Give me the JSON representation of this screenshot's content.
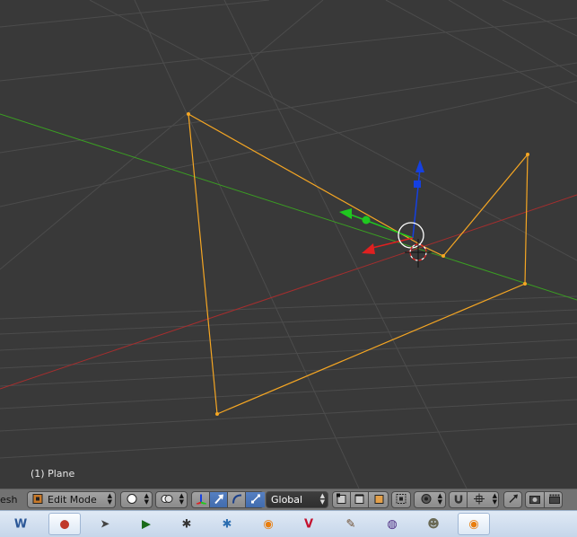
{
  "viewport": {
    "object_info": "(1) Plane"
  },
  "header": {
    "editor_label": "esh",
    "mode_label": "Edit Mode",
    "orientation_label": "Global"
  },
  "icons": {
    "mode": "edit-mode-icon",
    "shading": "solid-shading-icon",
    "pivot": "pivot-point-icon",
    "manipulator": "manipulator-axes-icon",
    "translate": "translate-arrow-icon",
    "rotate": "rotate-arc-icon",
    "scale": "scale-icon",
    "select_modes": [
      "vertex-select-icon",
      "edge-select-icon",
      "face-select-icon"
    ],
    "occlude": "occlude-geometry-icon",
    "proportional": "proportional-edit-icon",
    "magnet": "snap-magnet-icon",
    "snap_target": "snap-target-icon",
    "render_icons": [
      "opengl-render-icon",
      "render-image-icon",
      "render-animation-icon"
    ]
  },
  "taskbar": {
    "apps": [
      {
        "name": "word-icon",
        "glyph": "W",
        "color": "#2b5797",
        "active": false
      },
      {
        "name": "paint-icon",
        "glyph": "●",
        "color": "#c0392b",
        "active": true
      },
      {
        "name": "inkscape-icon",
        "glyph": "➤",
        "color": "#444444",
        "active": false
      },
      {
        "name": "terminal-icon",
        "glyph": "▶",
        "color": "#1a6b1a",
        "active": false
      },
      {
        "name": "settings-gear-icon",
        "glyph": "✱",
        "color": "#333333",
        "active": false
      },
      {
        "name": "network-gear-icon",
        "glyph": "✱",
        "color": "#2a6db0",
        "active": false
      },
      {
        "name": "blender-orange-icon",
        "glyph": "◉",
        "color": "#e87d0d",
        "active": false
      },
      {
        "name": "vivaldi-icon",
        "glyph": "V",
        "color": "#c4112e",
        "active": false
      },
      {
        "name": "pen-tool-icon",
        "glyph": "✎",
        "color": "#6b4a2b",
        "active": false
      },
      {
        "name": "media-player-icon",
        "glyph": "◍",
        "color": "#4b2a80",
        "active": false
      },
      {
        "name": "gimp-icon",
        "glyph": "☻",
        "color": "#6a6a55",
        "active": false
      },
      {
        "name": "blender-icon",
        "glyph": "◉",
        "color": "#e87d0d",
        "active": true
      }
    ]
  },
  "colors": {
    "viewport_bg": "#393939",
    "grid": "#4d4d4d",
    "x_axis": "#a62e2e",
    "y_axis": "#3a9e22",
    "selection": "#f5a623",
    "gizmo_x": "#e02020",
    "gizmo_y": "#1fc81f",
    "gizmo_z": "#1540e0"
  }
}
